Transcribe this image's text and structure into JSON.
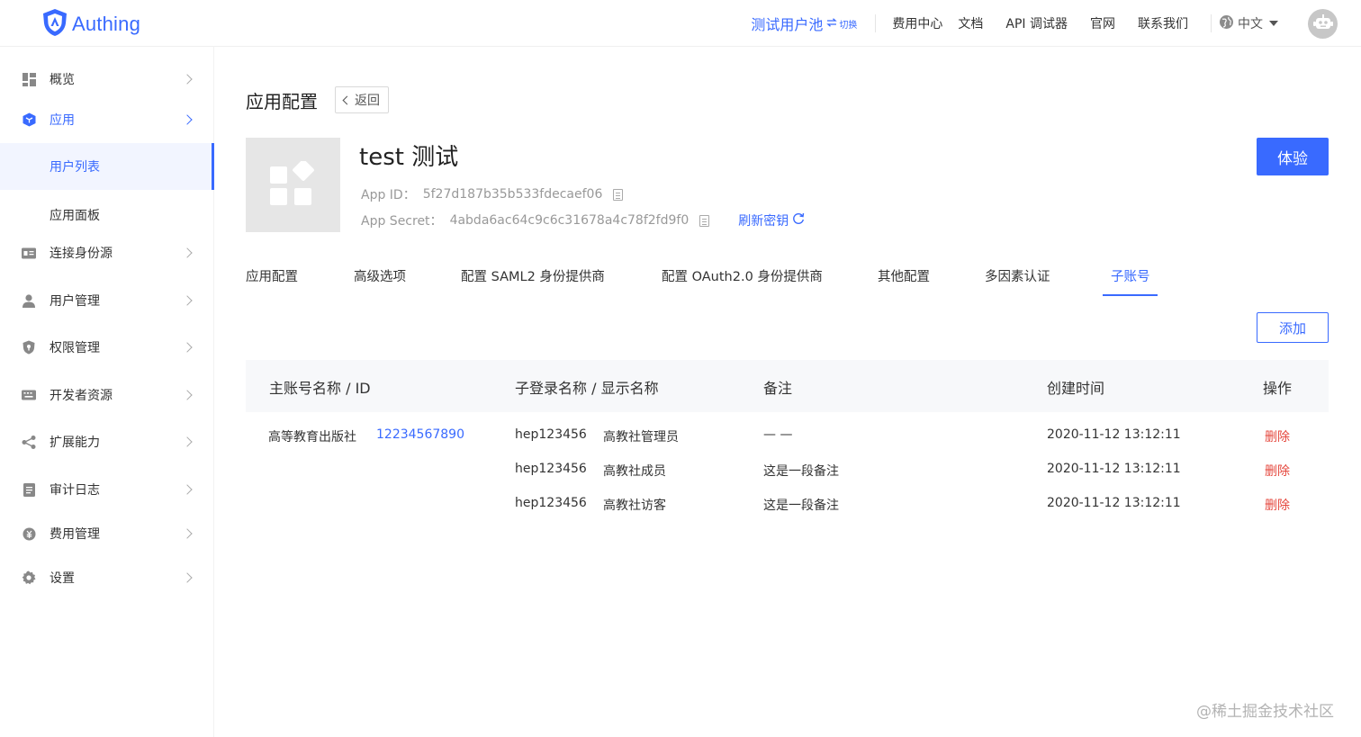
{
  "header": {
    "brand": "Authing",
    "user_pool": "测试用户池",
    "switch_label": "切换",
    "nav_links": [
      "费用中心",
      "文档",
      "API 调试器",
      "官网",
      "联系我们"
    ],
    "language": "中文",
    "colors": {
      "accent": "#396aff",
      "danger": "#e5473d"
    }
  },
  "sidebar": {
    "items": [
      {
        "label": "概览",
        "icon": "dashboard-icon"
      },
      {
        "label": "应用",
        "icon": "cube-icon",
        "active": true
      },
      {
        "label": "连接身份源",
        "icon": "id-card-icon"
      },
      {
        "label": "用户管理",
        "icon": "user-icon"
      },
      {
        "label": "权限管理",
        "icon": "shield-icon"
      },
      {
        "label": "开发者资源",
        "icon": "keyboard-icon"
      },
      {
        "label": "扩展能力",
        "icon": "share-icon"
      },
      {
        "label": "审计日志",
        "icon": "log-icon"
      },
      {
        "label": "费用管理",
        "icon": "coin-icon"
      },
      {
        "label": "设置",
        "icon": "gear-icon"
      }
    ],
    "sub_items": [
      {
        "label": "用户列表",
        "selected": true
      },
      {
        "label": "应用面板",
        "selected": false
      }
    ]
  },
  "page": {
    "title": "应用配置",
    "back_label": "返回",
    "app_name": "test 测试",
    "app_id_label": "App ID：",
    "app_id": "5f27d187b35b533fdecaef06",
    "app_secret_label": "App Secret：",
    "app_secret": "4abda6ac64c9c6c31678a4c78f2fd9f0",
    "refresh_label": "刷新密钥",
    "try_label": "体验",
    "tabs": [
      "应用配置",
      "高级选项",
      "配置 SAML2 身份提供商",
      "配置 OAuth2.0 身份提供商",
      "其他配置",
      "多因素认证",
      "子账号"
    ],
    "active_tab": "子账号",
    "add_label": "添加"
  },
  "table": {
    "headers": [
      "主账号名称 / ID",
      "子登录名称 / 显示名称",
      "备注",
      "创建时间",
      "操作"
    ],
    "main_account": {
      "name": "高等教育出版社",
      "id": "12234567890"
    },
    "rows": [
      {
        "login": "hep123456",
        "display": "高教社管理员",
        "note": "— —",
        "created": "2020-11-12 13:12:11",
        "action": "删除"
      },
      {
        "login": "hep123456",
        "display": "高教社成员",
        "note": "这是一段备注",
        "created": "2020-11-12 13:12:11",
        "action": "删除"
      },
      {
        "login": "hep123456",
        "display": "高教社访客",
        "note": "这是一段备注",
        "created": "2020-11-12 13:12:11",
        "action": "删除"
      }
    ]
  },
  "watermark": "@稀土掘金技术社区"
}
